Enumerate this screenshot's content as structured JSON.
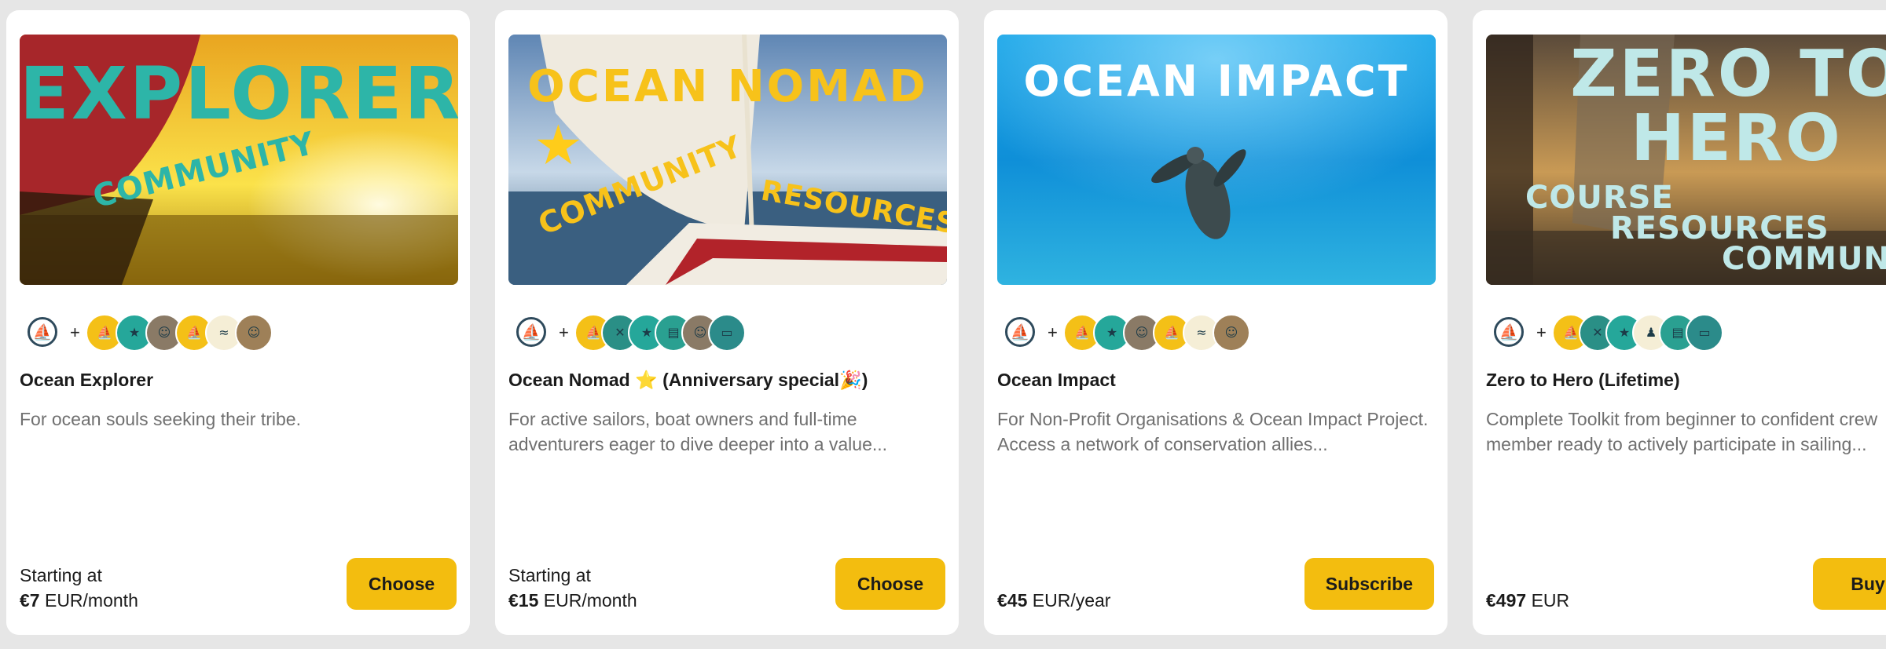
{
  "colors": {
    "page_bg": "#e6e6e6",
    "card_bg": "#ffffff",
    "button_bg": "#f3bd0f",
    "title_text": "#1b1b1b",
    "desc_text": "#707070",
    "logo": "#2e4a5c"
  },
  "plus_symbol": "+",
  "logo_icon": "sailboat-logo-icon",
  "cards": [
    {
      "banner": {
        "title": "EXPLORER",
        "tags": [
          "COMMUNITY"
        ],
        "scene": "sunset sail"
      },
      "avatars": [
        "yellow-boat",
        "teal-badge",
        "person-photo",
        "yellow-boat",
        "teal-wave",
        "person-photo"
      ],
      "title": "Ocean Explorer",
      "description": "For ocean souls seeking their tribe.",
      "price_label": "Starting at",
      "price_amount": "€7",
      "price_unit": "EUR/month",
      "button": "Choose"
    },
    {
      "banner": {
        "title": "OCEAN NOMAD",
        "tags": [
          "COMMUNITY",
          "RESOURCES"
        ],
        "scene": "sailboat deck"
      },
      "avatars": [
        "yellow-boat",
        "teal-tools",
        "teal-badge",
        "teal-folder",
        "person-photo",
        "teal-van"
      ],
      "title": "Ocean Nomad ⭐ (Anniversary special🎉)",
      "description": "For active sailors, boat owners and full-time adventurers eager to dive deeper into a value...",
      "price_label": "Starting at",
      "price_amount": "€15",
      "price_unit": "EUR/month",
      "button": "Choose"
    },
    {
      "banner": {
        "title": "OCEAN IMPACT",
        "tags": [],
        "scene": "turtle underwater"
      },
      "avatars": [
        "yellow-boat",
        "teal-badge",
        "person-photo",
        "yellow-boat",
        "teal-wave",
        "person-photo"
      ],
      "title": "Ocean Impact",
      "description": "For Non-Profit Organisations & Ocean Impact Project. Access a network of conservation allies...",
      "price_label": "",
      "price_amount": "€45",
      "price_unit": "EUR/year",
      "button": "Subscribe"
    },
    {
      "banner": {
        "title": "ZERO TO HERO",
        "tags": [
          "COURSE",
          "RESOURCES",
          "COMMUNITY"
        ],
        "scene": "sail at dusk"
      },
      "avatars": [
        "yellow-boat",
        "teal-tools",
        "teal-badge",
        "person-sketch",
        "teal-folder",
        "teal-van"
      ],
      "title": "Zero to Hero (Lifetime)",
      "description": "Complete Toolkit from beginner to confident crew member ready to actively participate in sailing...",
      "price_label": "",
      "price_amount": "€497",
      "price_unit": "EUR",
      "button": "Buy"
    }
  ]
}
